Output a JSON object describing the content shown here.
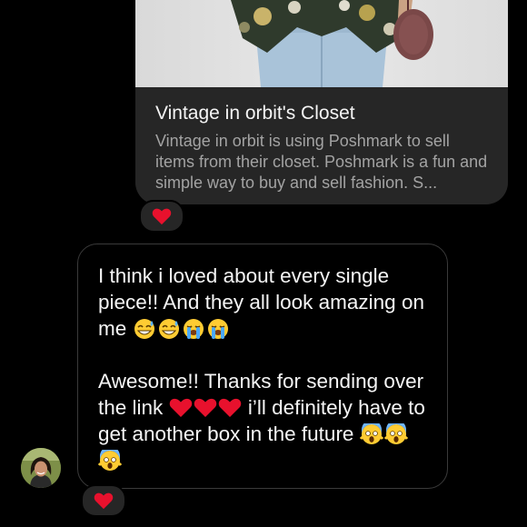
{
  "link_card": {
    "title": "Vintage in orbit's Closet",
    "description": "Vintage in orbit is using Poshmark to sell items from their closet. Poshmark is a fun and simple way to buy and sell fashion. S...",
    "image_icon": "outfit-photo"
  },
  "message": {
    "para1": "I think i loved about every single piece!! And they all look amazing on me",
    "para2_start": "Awesome!! Thanks for sending over the link",
    "para2_mid": "i’ll definitely have to get another box in the future",
    "emoji_set1": [
      "grinning-sweat-emoji",
      "grinning-sweat-emoji",
      "loudly-crying-emoji",
      "loudly-crying-emoji"
    ],
    "emoji_set2": [
      "red-heart-emoji",
      "red-heart-emoji",
      "red-heart-emoji"
    ],
    "emoji_set3": [
      "screaming-fear-emoji",
      "screaming-fear-emoji",
      "screaming-fear-emoji"
    ]
  },
  "reactions": {
    "card_reaction": "red-heart-icon",
    "message_reaction": "red-heart-icon"
  },
  "colors": {
    "background": "#000000",
    "card_bg": "#262626",
    "bubble_border": "#3a3a3a",
    "heart": "#e8112d"
  }
}
